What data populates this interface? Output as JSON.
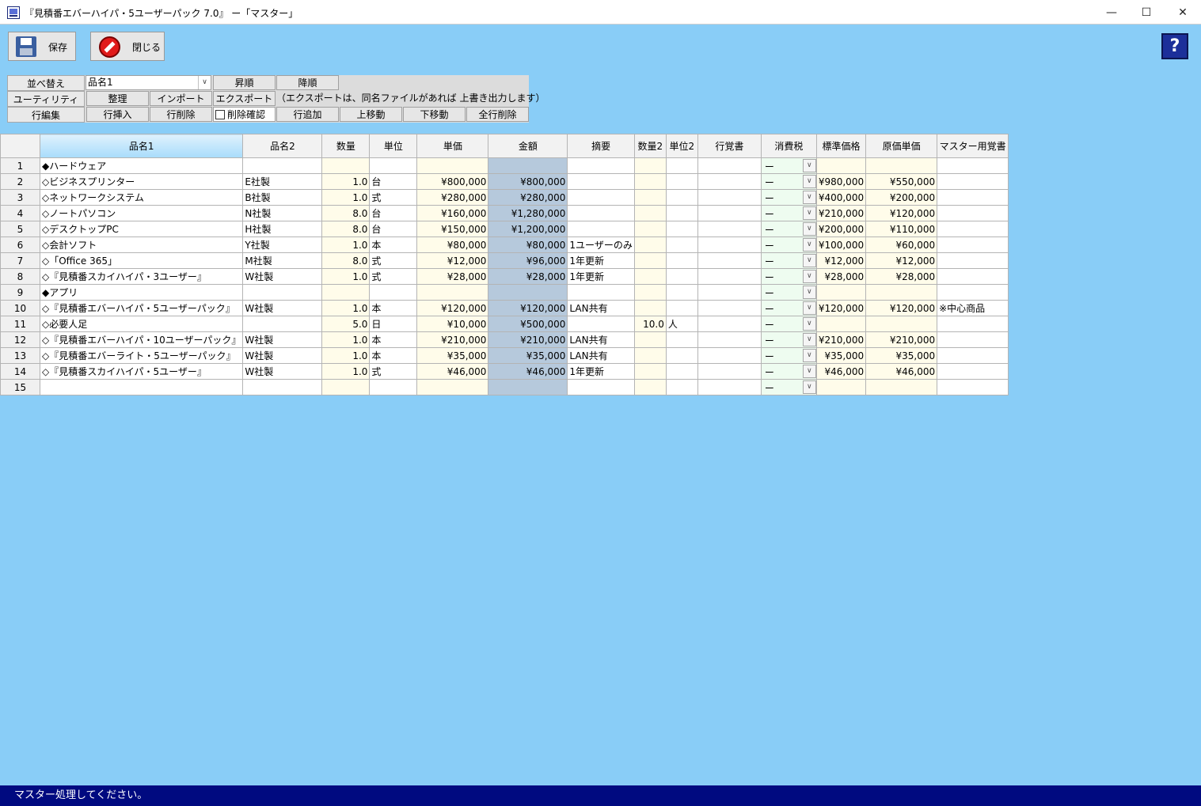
{
  "window": {
    "title": "『見積番エバーハイパ・5ユーザーパック 7.0』 ー「マスター」",
    "min_glyph": "—",
    "max_glyph": "☐",
    "close_glyph": "✕"
  },
  "toolbar": {
    "save_label": "保存",
    "close_label": "閉じる",
    "help_glyph": "?"
  },
  "panel": {
    "sort_label": "並べ替え",
    "sort_value": "品名1",
    "asc_label": "昇順",
    "desc_label": "降順",
    "utility_label": "ユーティリティ",
    "organize_label": "整理",
    "import_label": "インポート",
    "export_label": "エクスポート",
    "export_note": "（エクスポートは、同名ファイルがあれば 上書き出力します）",
    "edit_label": "行編集",
    "insert_label": "行挿入",
    "delete_label": "行削除",
    "confirm_label": "削除確認",
    "add_label": "行追加",
    "up_label": "上移動",
    "down_label": "下移動",
    "clear_label": "全行削除"
  },
  "grid": {
    "headers": [
      "品名1",
      "品名2",
      "数量",
      "単位",
      "単価",
      "金額",
      "摘要",
      "数量2",
      "単位2",
      "行覚書",
      "消費税",
      "標準価格",
      "原価単価",
      "マスター用覚書"
    ],
    "rows": [
      {
        "no": "1",
        "name1": "◆ハードウェア",
        "name2": "",
        "qty": "",
        "unit": "",
        "price": "",
        "amount": "",
        "note": "",
        "qty2": "",
        "unit2": "",
        "memo": "",
        "tax": "ー",
        "std": "",
        "cost": "",
        "mmemo": ""
      },
      {
        "no": "2",
        "name1": "◇ビジネスプリンター",
        "name2": "E社製",
        "qty": "1.0",
        "unit": "台",
        "price": "¥800,000",
        "amount": "¥800,000",
        "note": "",
        "qty2": "",
        "unit2": "",
        "memo": "",
        "tax": "ー",
        "std": "¥980,000",
        "cost": "¥550,000",
        "mmemo": ""
      },
      {
        "no": "3",
        "name1": "◇ネットワークシステム",
        "name2": "B社製",
        "qty": "1.0",
        "unit": "式",
        "price": "¥280,000",
        "amount": "¥280,000",
        "note": "",
        "qty2": "",
        "unit2": "",
        "memo": "",
        "tax": "ー",
        "std": "¥400,000",
        "cost": "¥200,000",
        "mmemo": ""
      },
      {
        "no": "4",
        "name1": "◇ノートパソコン",
        "name2": "N社製",
        "qty": "8.0",
        "unit": "台",
        "price": "¥160,000",
        "amount": "¥1,280,000",
        "note": "",
        "qty2": "",
        "unit2": "",
        "memo": "",
        "tax": "ー",
        "std": "¥210,000",
        "cost": "¥120,000",
        "mmemo": ""
      },
      {
        "no": "5",
        "name1": "◇デスクトップPC",
        "name2": "H社製",
        "qty": "8.0",
        "unit": "台",
        "price": "¥150,000",
        "amount": "¥1,200,000",
        "note": "",
        "qty2": "",
        "unit2": "",
        "memo": "",
        "tax": "ー",
        "std": "¥200,000",
        "cost": "¥110,000",
        "mmemo": ""
      },
      {
        "no": "6",
        "name1": "◇会計ソフト",
        "name2": "Y社製",
        "qty": "1.0",
        "unit": "本",
        "price": "¥80,000",
        "amount": "¥80,000",
        "note": "1ユーザーのみ",
        "qty2": "",
        "unit2": "",
        "memo": "",
        "tax": "ー",
        "std": "¥100,000",
        "cost": "¥60,000",
        "mmemo": ""
      },
      {
        "no": "7",
        "name1": "◇「Office 365」",
        "name2": "M社製",
        "qty": "8.0",
        "unit": "式",
        "price": "¥12,000",
        "amount": "¥96,000",
        "note": "1年更新",
        "qty2": "",
        "unit2": "",
        "memo": "",
        "tax": "ー",
        "std": "¥12,000",
        "cost": "¥12,000",
        "mmemo": ""
      },
      {
        "no": "8",
        "name1": "◇『見積番スカイハイパ・3ユーザー』",
        "name2": "W社製",
        "qty": "1.0",
        "unit": "式",
        "price": "¥28,000",
        "amount": "¥28,000",
        "note": "1年更新",
        "qty2": "",
        "unit2": "",
        "memo": "",
        "tax": "ー",
        "std": "¥28,000",
        "cost": "¥28,000",
        "mmemo": ""
      },
      {
        "no": "9",
        "name1": "◆アプリ",
        "name2": "",
        "qty": "",
        "unit": "",
        "price": "",
        "amount": "",
        "note": "",
        "qty2": "",
        "unit2": "",
        "memo": "",
        "tax": "ー",
        "std": "",
        "cost": "",
        "mmemo": ""
      },
      {
        "no": "10",
        "name1": "◇『見積番エバーハイパ・5ユーザーパック』",
        "name2": "W社製",
        "qty": "1.0",
        "unit": "本",
        "price": "¥120,000",
        "amount": "¥120,000",
        "note": "LAN共有",
        "qty2": "",
        "unit2": "",
        "memo": "",
        "tax": "ー",
        "std": "¥120,000",
        "cost": "¥120,000",
        "mmemo": "※中心商品"
      },
      {
        "no": "11",
        "name1": "◇必要人足",
        "name2": "",
        "qty": "5.0",
        "unit": "日",
        "price": "¥10,000",
        "amount": "¥500,000",
        "note": "",
        "qty2": "10.0",
        "unit2": "人",
        "memo": "",
        "tax": "ー",
        "std": "",
        "cost": "",
        "mmemo": ""
      },
      {
        "no": "12",
        "name1": "◇『見積番エバーハイパ・10ユーザーパック』",
        "name2": "W社製",
        "qty": "1.0",
        "unit": "本",
        "price": "¥210,000",
        "amount": "¥210,000",
        "note": "LAN共有",
        "qty2": "",
        "unit2": "",
        "memo": "",
        "tax": "ー",
        "std": "¥210,000",
        "cost": "¥210,000",
        "mmemo": ""
      },
      {
        "no": "13",
        "name1": "◇『見積番エバーライト・5ユーザーパック』",
        "name2": "W社製",
        "qty": "1.0",
        "unit": "本",
        "price": "¥35,000",
        "amount": "¥35,000",
        "note": "LAN共有",
        "qty2": "",
        "unit2": "",
        "memo": "",
        "tax": "ー",
        "std": "¥35,000",
        "cost": "¥35,000",
        "mmemo": ""
      },
      {
        "no": "14",
        "name1": "◇『見積番スカイハイパ・5ユーザー』",
        "name2": "W社製",
        "qty": "1.0",
        "unit": "式",
        "price": "¥46,000",
        "amount": "¥46,000",
        "note": "1年更新",
        "qty2": "",
        "unit2": "",
        "memo": "",
        "tax": "ー",
        "std": "¥46,000",
        "cost": "¥46,000",
        "mmemo": ""
      },
      {
        "no": "15",
        "name1": "",
        "name2": "",
        "qty": "",
        "unit": "",
        "price": "",
        "amount": "",
        "note": "",
        "qty2": "",
        "unit2": "",
        "memo": "",
        "tax": "ー",
        "std": "",
        "cost": "",
        "mmemo": ""
      }
    ]
  },
  "status": {
    "message": "マスター処理してください。"
  },
  "icons": {
    "save": "floppy-disk-icon",
    "close": "no-entry-icon",
    "help": "help-icon",
    "dropdown_glyph": "∨"
  }
}
